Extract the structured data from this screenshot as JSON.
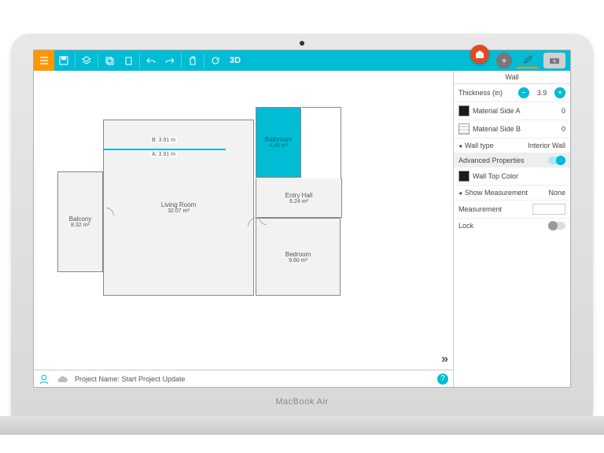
{
  "brand": "MacBook Air",
  "toolbar": {
    "threed": "3D"
  },
  "homeBadge": "home",
  "tabs": {
    "add": "+",
    "pencil": "edit",
    "camera": "cam"
  },
  "panel": {
    "title": "Wall",
    "thickness": {
      "label": "Thickness (in)",
      "value": "3.9"
    },
    "matA": {
      "label": "Material Side A",
      "value": "0"
    },
    "matB": {
      "label": "Material Side B",
      "value": "0"
    },
    "walltype": {
      "label": "Wall type",
      "value": "Interior Wall"
    },
    "advanced": "Advanced Properties",
    "topcolor": "Wall Top Color",
    "showmeas": {
      "label": "Show Measurement",
      "value": "None"
    },
    "measurement": "Measurement",
    "lock": "Lock"
  },
  "rooms": {
    "balcony": {
      "name": "Balcony",
      "area": "8.32 m²"
    },
    "living": {
      "name": "Living Room",
      "area": "32.07 m²"
    },
    "bathroom": {
      "name": "Bathroom",
      "area": "4.46 m²"
    },
    "entry": {
      "name": "Entry Hall",
      "area": "6.24 m²"
    },
    "bedroom": {
      "name": "Bedroom",
      "area": "9.60 m²"
    }
  },
  "dims": {
    "b": "B: 3.91 m",
    "a": "A: 3.91 m"
  },
  "footer": {
    "project": "Project Name: Start Project Update"
  }
}
